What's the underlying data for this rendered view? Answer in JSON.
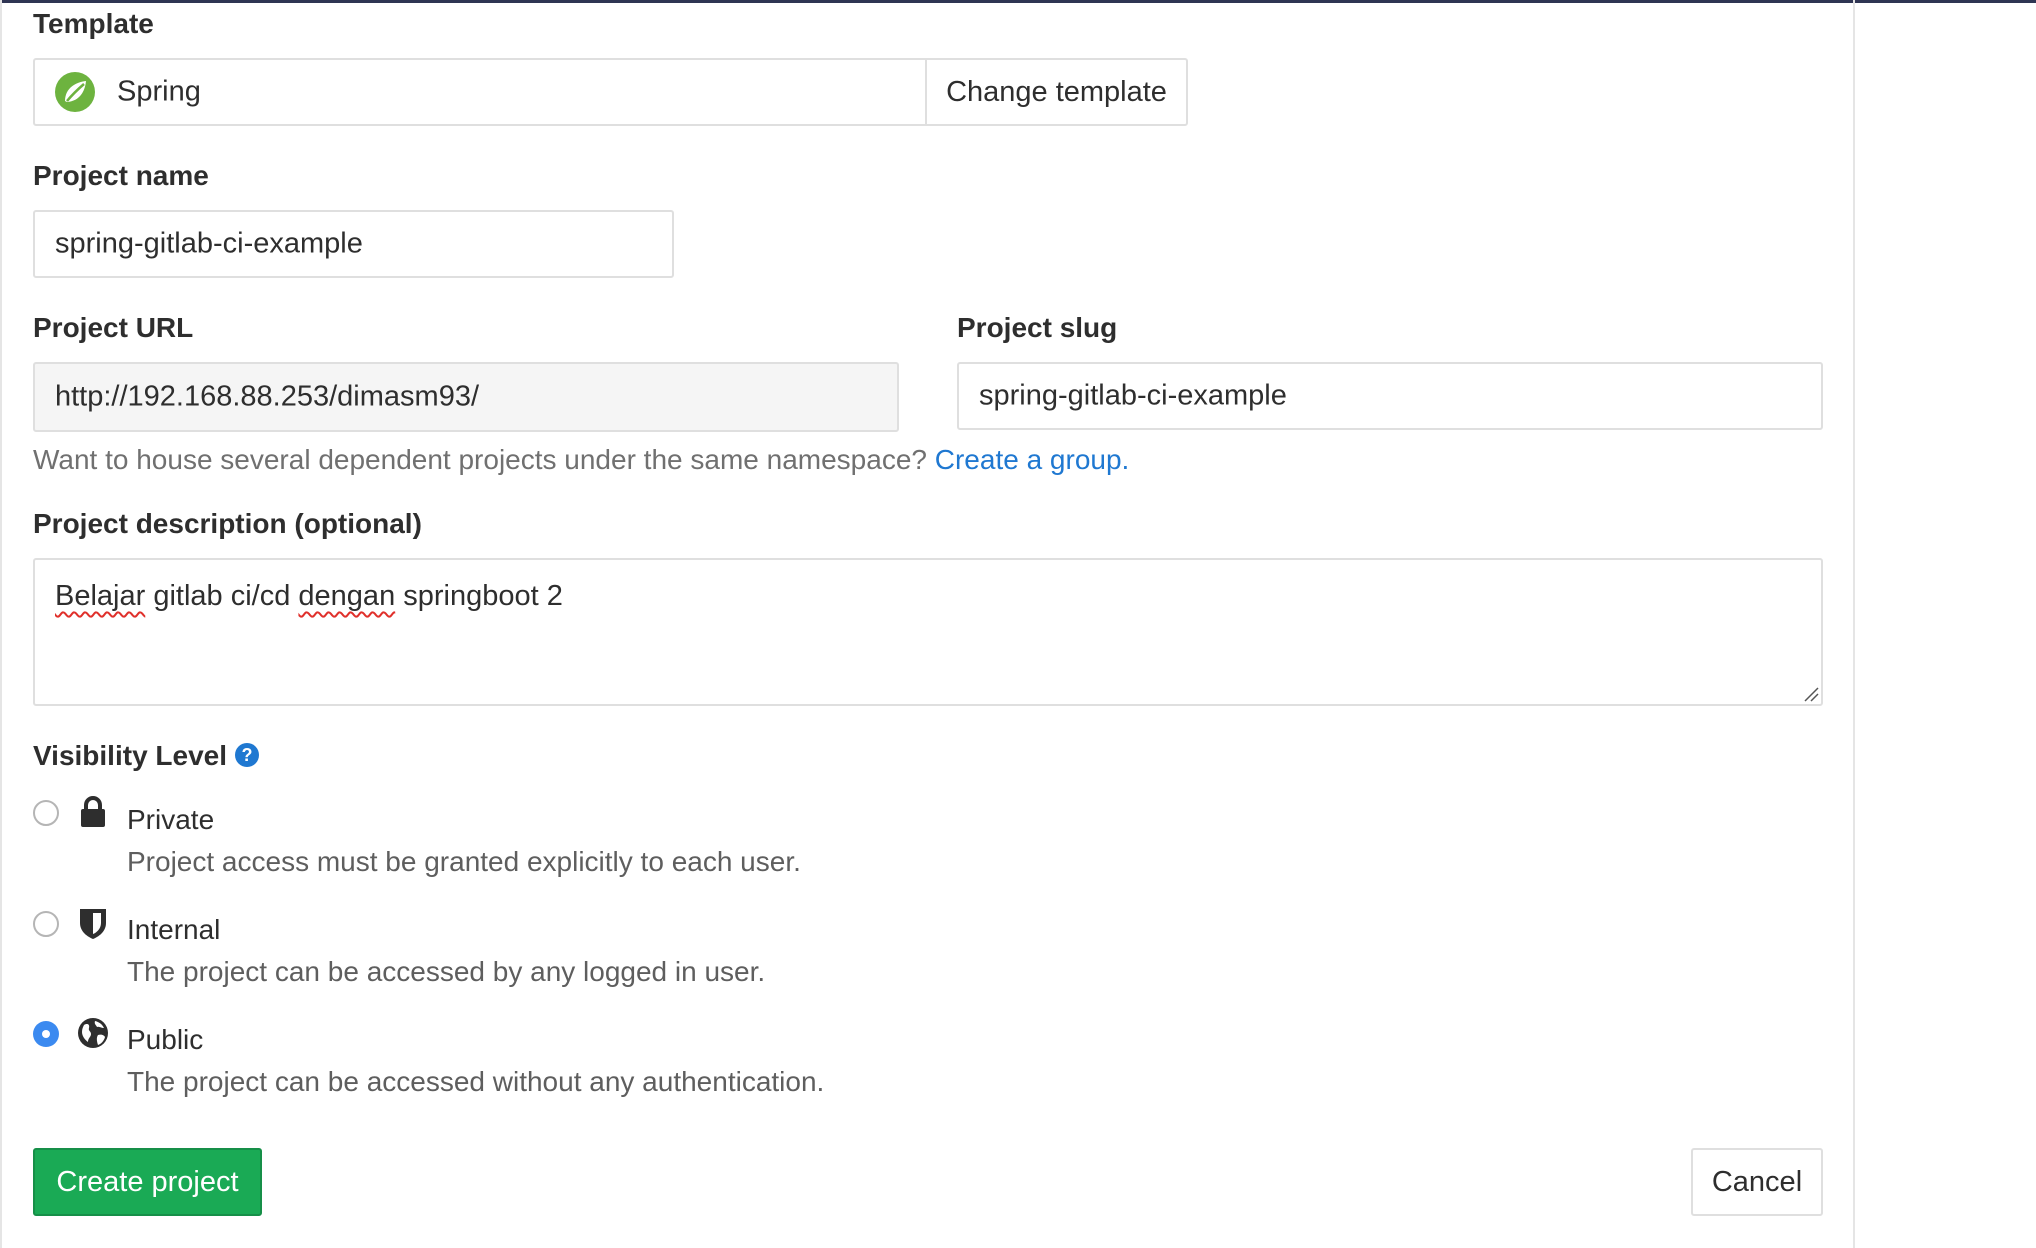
{
  "template": {
    "label": "Template",
    "selected": "Spring",
    "change_label": "Change template"
  },
  "project_name": {
    "label": "Project name",
    "value": "spring-gitlab-ci-example"
  },
  "project_url": {
    "label": "Project URL",
    "value": "http://192.168.88.253/dimasm93/"
  },
  "project_slug": {
    "label": "Project slug",
    "value": "spring-gitlab-ci-example"
  },
  "namespace_help": {
    "text": "Want to house several dependent projects under the same namespace?",
    "link": "Create a group."
  },
  "description": {
    "label": "Project description (optional)",
    "word1": "Belajar",
    "mid": " gitlab ci/cd ",
    "word2": "dengan",
    "tail": " springboot 2"
  },
  "visibility": {
    "label": "Visibility Level",
    "help_glyph": "?",
    "selected": "Public",
    "options": [
      {
        "title": "Private",
        "description": "Project access must be granted explicitly to each user.",
        "icon": "lock-icon"
      },
      {
        "title": "Internal",
        "description": "The project can be accessed by any logged in user.",
        "icon": "shield-icon"
      },
      {
        "title": "Public",
        "description": "The project can be accessed without any authentication.",
        "icon": "globe-icon"
      }
    ]
  },
  "actions": {
    "create": "Create project",
    "cancel": "Cancel"
  },
  "colors": {
    "primary_green": "#1aaa55",
    "link_blue": "#1f78d1",
    "radio_blue": "#3b8af0",
    "spring_green": "#6db33f"
  }
}
